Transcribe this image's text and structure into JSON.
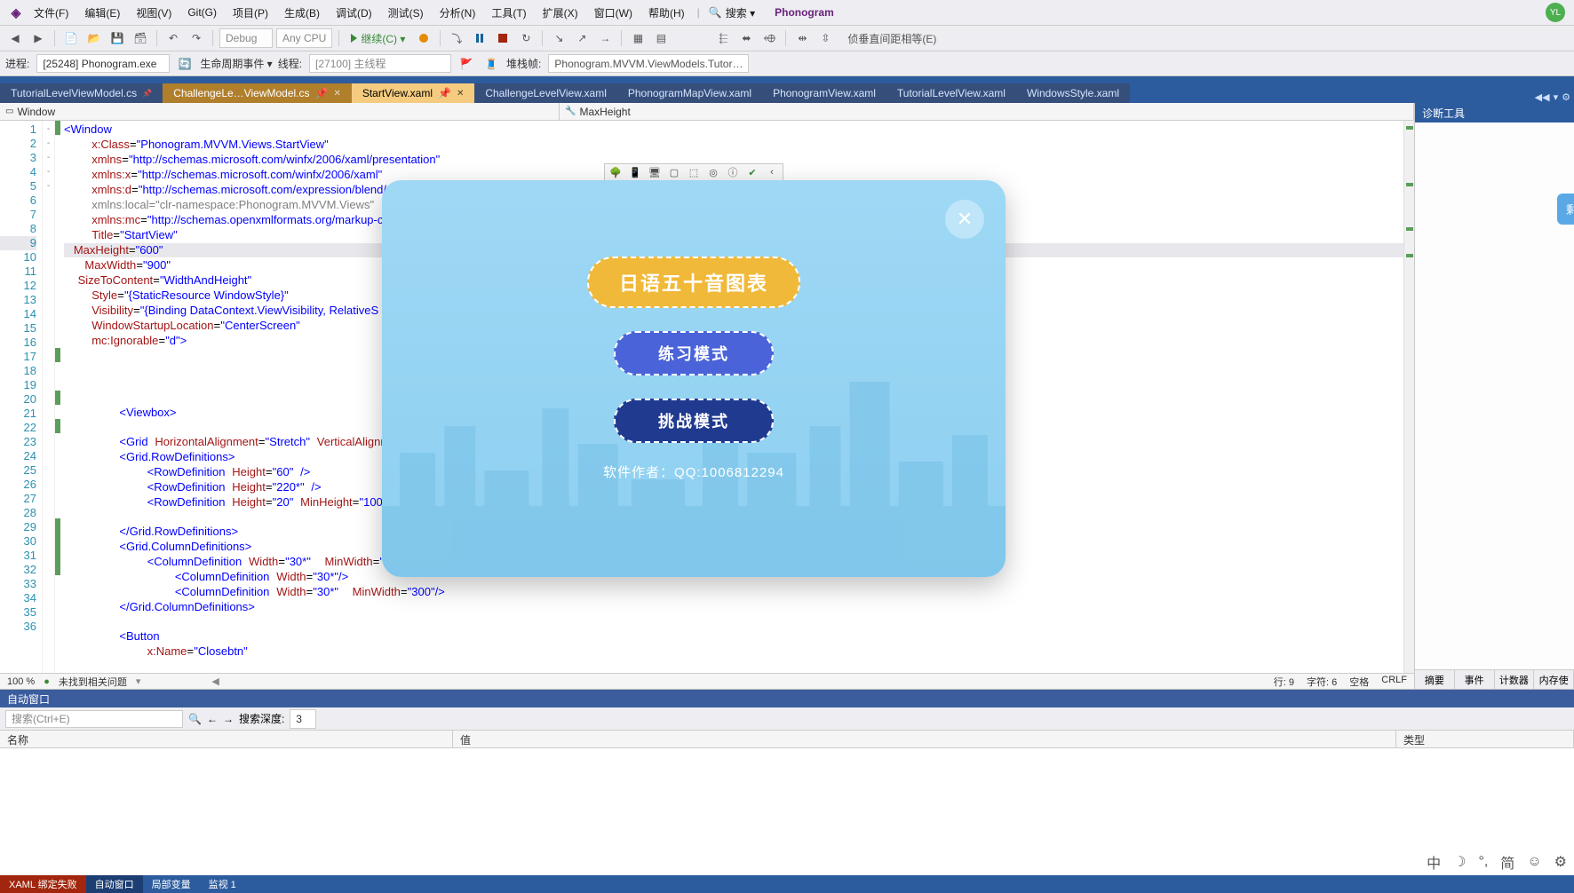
{
  "menu": {
    "items": [
      "文件(F)",
      "编辑(E)",
      "视图(V)",
      "Git(G)",
      "项目(P)",
      "生成(B)",
      "调试(D)",
      "测试(S)",
      "分析(N)",
      "工具(T)",
      "扩展(X)",
      "窗口(W)",
      "帮助(H)"
    ],
    "search_label": "搜索 ▾",
    "solution": "Phonogram",
    "user_initials": "YL"
  },
  "toolbar": {
    "config": "Debug",
    "platform": "Any CPU",
    "continue_label": "继续(C) ▾",
    "right_label": "侦垂直间距相等(E)"
  },
  "debugbar": {
    "process_label": "进程:",
    "process_value": "[25248] Phonogram.exe",
    "lifecycle_label": "生命周期事件 ▾",
    "thread_label": "线程:",
    "thread_value": "[27100] 主线程",
    "stackframe_label": "堆栈帧:",
    "stackframe_value": "Phonogram.MVVM.ViewModels.Tutor…"
  },
  "tabs": [
    {
      "label": "TutorialLevelViewModel.cs",
      "state": "pinned"
    },
    {
      "label": "ChallengeLe…ViewModel.cs",
      "state": "preview"
    },
    {
      "label": "StartView.xaml",
      "state": "active"
    },
    {
      "label": "ChallengeLevelView.xaml",
      "state": ""
    },
    {
      "label": "PhonogramMapView.xaml",
      "state": ""
    },
    {
      "label": "PhonogramView.xaml",
      "state": ""
    },
    {
      "label": "TutorialLevelView.xaml",
      "state": ""
    },
    {
      "label": "WindowsStyle.xaml",
      "state": ""
    }
  ],
  "nav": {
    "left": "Window",
    "right": "MaxHeight"
  },
  "status": {
    "zoom": "100 %",
    "issues": "未找到相关问题",
    "line": "行: 9",
    "char": "字符: 6",
    "spaces": "空格",
    "eol": "CRLF"
  },
  "diag": {
    "title": "诊断工具",
    "float": "剩余时",
    "tabs": [
      "摘要",
      "事件",
      "计数器",
      "内存使用率"
    ]
  },
  "autos": {
    "title": "自动窗口",
    "search_placeholder": "搜索(Ctrl+E)",
    "depth_label": "搜索深度:",
    "depth_value": "3",
    "cols": [
      "名称",
      "值",
      "类型"
    ]
  },
  "footer": {
    "tabs": [
      {
        "label": "XAML 绑定失败",
        "err": true
      },
      {
        "label": "自动窗口",
        "active": true
      },
      {
        "label": "局部变量"
      },
      {
        "label": "监视 1"
      }
    ]
  },
  "ime": [
    "中",
    "☽",
    "°,",
    "简",
    "☺",
    "⚙"
  ],
  "app": {
    "btn1": "日语五十音图表",
    "btn2": "练习模式",
    "btn3": "挑战模式",
    "credit": "软件作者：QQ:1006812294"
  },
  "code_lines": [
    {
      "n": 1,
      "fold": "-",
      "chg": "grn"
    },
    {
      "n": 2,
      "chg": ""
    },
    {
      "n": 3,
      "chg": ""
    },
    {
      "n": 4,
      "chg": ""
    },
    {
      "n": 5,
      "chg": ""
    },
    {
      "n": 6,
      "chg": ""
    },
    {
      "n": 7,
      "chg": ""
    },
    {
      "n": 8,
      "chg": ""
    },
    {
      "n": 9,
      "chg": "",
      "cur": true
    },
    {
      "n": 10,
      "chg": ""
    },
    {
      "n": 11,
      "chg": ""
    },
    {
      "n": 12,
      "chg": ""
    },
    {
      "n": 13,
      "chg": ""
    },
    {
      "n": 14,
      "chg": ""
    },
    {
      "n": 15,
      "chg": ""
    },
    {
      "n": 16,
      "chg": ""
    },
    {
      "n": 17,
      "chg": "grn"
    },
    {
      "n": 18,
      "chg": ""
    },
    {
      "n": 19,
      "chg": ""
    },
    {
      "n": 20,
      "chg": "grn"
    },
    {
      "n": 21,
      "chg": ""
    },
    {
      "n": 22,
      "fold": "-",
      "chg": "grn"
    },
    {
      "n": 23,
      "fold": "-",
      "chg": ""
    },
    {
      "n": 24,
      "chg": ""
    },
    {
      "n": 25,
      "chg": ""
    },
    {
      "n": 26,
      "chg": ""
    },
    {
      "n": 27,
      "chg": ""
    },
    {
      "n": 28,
      "chg": ""
    },
    {
      "n": 29,
      "fold": "-",
      "chg": "grn"
    },
    {
      "n": 30,
      "chg": "grn"
    },
    {
      "n": 31,
      "chg": "grn"
    },
    {
      "n": 32,
      "chg": "grn"
    },
    {
      "n": 33,
      "chg": ""
    },
    {
      "n": 34,
      "chg": ""
    },
    {
      "n": 35,
      "fold": "-",
      "chg": ""
    },
    {
      "n": 36,
      "chg": ""
    }
  ]
}
